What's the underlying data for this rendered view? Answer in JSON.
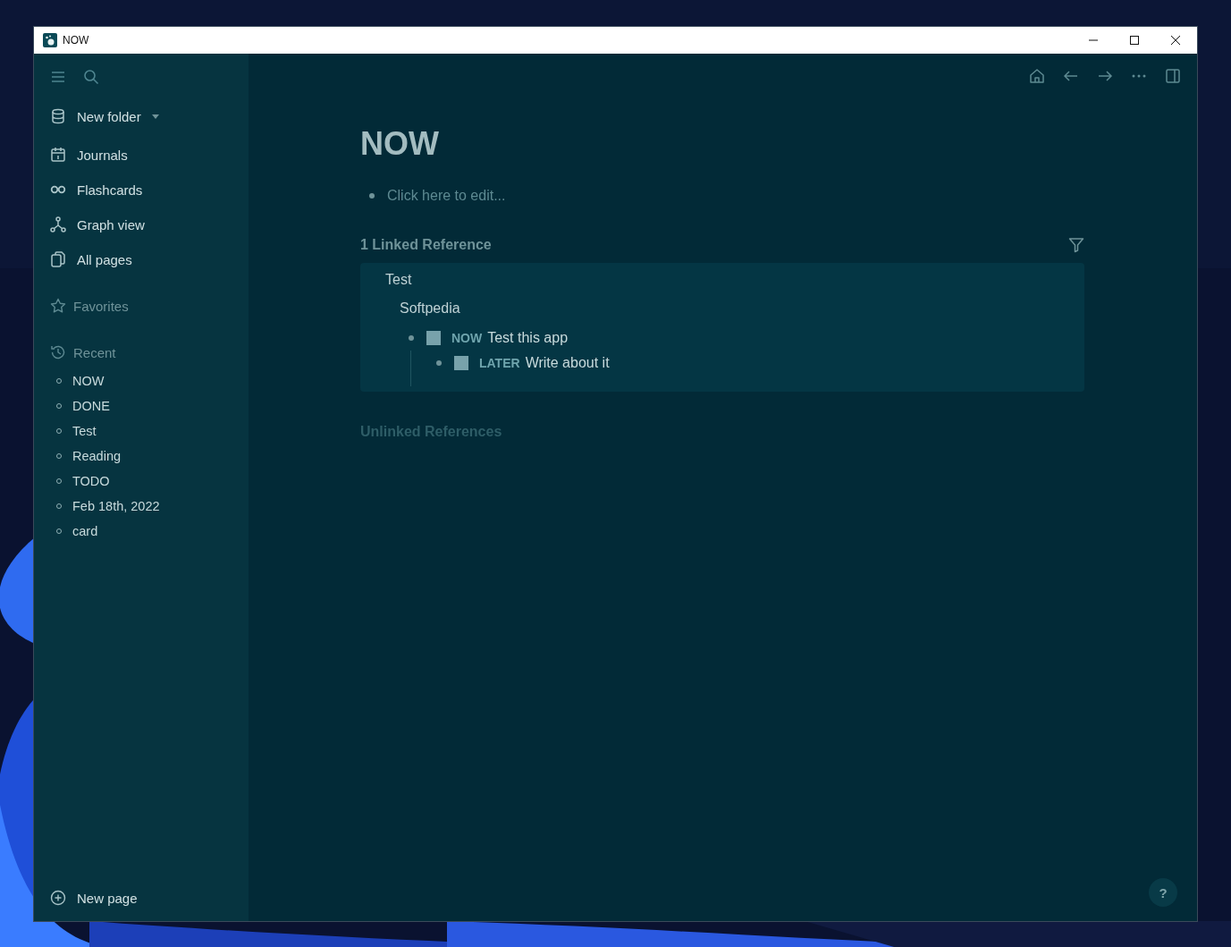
{
  "window": {
    "title": "NOW"
  },
  "sidebar": {
    "folder": "New folder",
    "nav": [
      {
        "kind": "journals",
        "label": "Journals"
      },
      {
        "kind": "flashcards",
        "label": "Flashcards"
      },
      {
        "kind": "graph",
        "label": "Graph view"
      },
      {
        "kind": "pages",
        "label": "All pages"
      }
    ],
    "favorites": "Favorites",
    "recent": {
      "label": "Recent",
      "items": [
        "NOW",
        "DONE",
        "Test",
        "Reading",
        "TODO",
        "Feb 18th, 2022",
        "card"
      ]
    },
    "new_page": "New page"
  },
  "page": {
    "title": "NOW",
    "placeholder": "Click here to edit...",
    "linked": {
      "heading": "1 Linked Reference",
      "page": "Test",
      "parent": "Softpedia",
      "blocks": [
        {
          "marker": "NOW",
          "text": "Test this app",
          "checked": false,
          "children": [
            {
              "marker": "LATER",
              "text": "Write about it",
              "checked": false
            }
          ]
        }
      ]
    },
    "unlinked": "Unlinked References"
  },
  "help": "?"
}
